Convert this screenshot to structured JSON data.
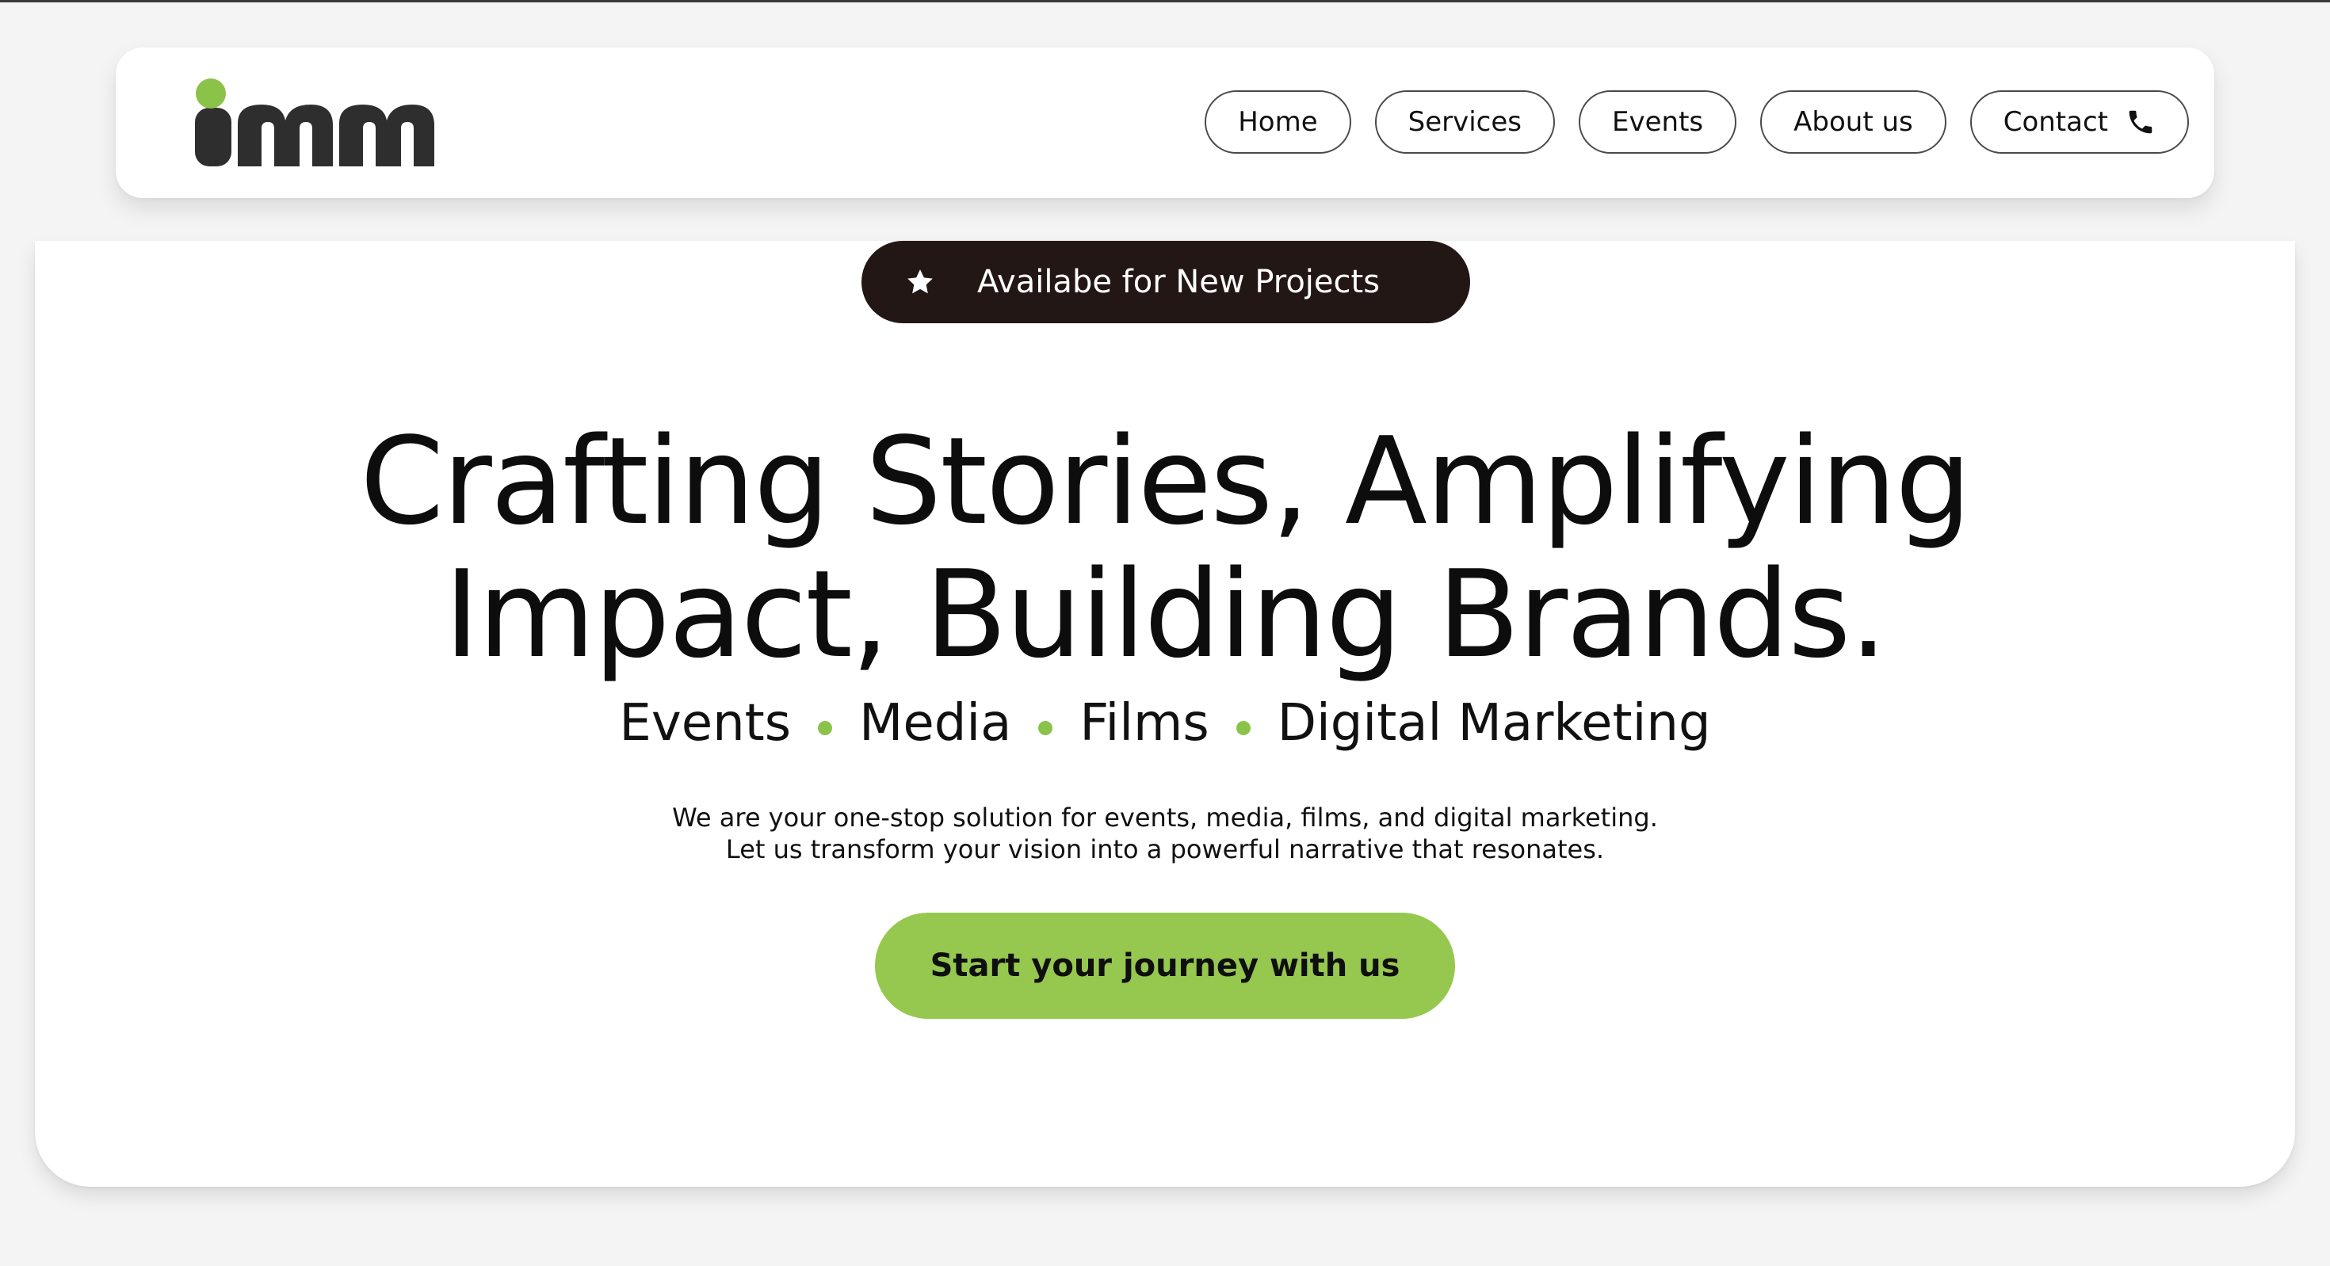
{
  "nav": {
    "items": [
      {
        "label": "Home"
      },
      {
        "label": "Services"
      },
      {
        "label": "Events"
      },
      {
        "label": "About us"
      },
      {
        "label": "Contact",
        "icon": "phone-icon"
      }
    ]
  },
  "hero": {
    "badge": {
      "icon": "star-icon",
      "label": "Availabe for New Projects"
    },
    "headline": {
      "line1": "Crafting Stories, Amplifying",
      "line2": "Impact, Building Brands."
    },
    "services": [
      "Events",
      "Media",
      "Films",
      "Digital Marketing"
    ],
    "description": {
      "line1": "We are your one-stop solution for events, media, films, and digital marketing.",
      "line2": "Let us transform your vision into a powerful narrative that resonates."
    },
    "cta_label": "Start your journey with us"
  },
  "colors": {
    "accent": "#96c74f",
    "dark": "#231716",
    "logo": "#2e2e2e"
  }
}
